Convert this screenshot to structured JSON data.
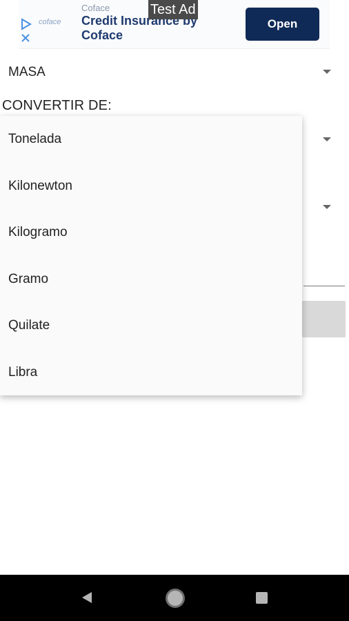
{
  "ad": {
    "advertiser": "Coface",
    "logo_text": "coface",
    "headline": "Credit Insurance by Coface",
    "badge": "Test Ad",
    "cta": "Open"
  },
  "category_spinner": {
    "value": "MASA"
  },
  "convert_from": {
    "label": "CONVERTIR DE:"
  },
  "dropdown": {
    "options": [
      "Tonelada",
      "Kilonewton",
      "Kilogramo",
      "Gramo",
      "Quilate",
      "Libra"
    ]
  }
}
